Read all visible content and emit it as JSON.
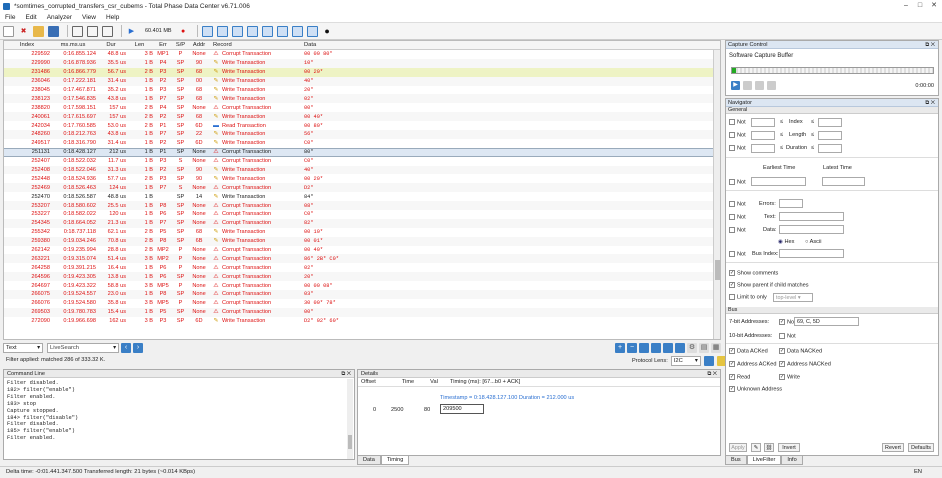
{
  "window": {
    "title": "*somtimes_corrupted_transfers_csr_cubems - Total Phase Data Center v6.71.006",
    "min": "–",
    "max": "□",
    "close": "✕"
  },
  "menu": [
    "File",
    "Edit",
    "Analyzer",
    "View",
    "Help"
  ],
  "toolbar": {
    "capture_size": "60.401 MB"
  },
  "table": {
    "headers": [
      "Index",
      "ms.ms.us",
      "Dur",
      "Len",
      "Err",
      "S/P",
      "Addr",
      "Record",
      "Data"
    ],
    "rows": [
      {
        "idx": "229592",
        "time": "0:16.855.124",
        "dur": "48.8 us",
        "len": "3 B",
        "err": "MP1",
        "sp": "P",
        "addr": "None",
        "icon": "warn",
        "rec": "Corrupt Transaction",
        "data": "00 00 80*",
        "style": "red"
      },
      {
        "idx": "229990",
        "time": "0:16.878.936",
        "dur": "35.5 us",
        "len": "1 B",
        "err": "P4",
        "sp": "SP",
        "addr": "90",
        "icon": "pen",
        "rec": "Write Transaction",
        "data": "10*",
        "style": "red"
      },
      {
        "idx": "231486",
        "time": "0:16.866.779",
        "dur": "56.7 us",
        "len": "2 B",
        "err": "P3",
        "sp": "SP",
        "addr": "68",
        "icon": "pen",
        "rec": "Write Transaction",
        "data": "00 20*",
        "style": "red hl1"
      },
      {
        "idx": "236046",
        "time": "0:17.222.181",
        "dur": "31.4 us",
        "len": "1 B",
        "err": "P2",
        "sp": "SP",
        "addr": "00",
        "icon": "pen",
        "rec": "Write Transaction",
        "data": "40*",
        "style": "red"
      },
      {
        "idx": "238045",
        "time": "0:17.467.871",
        "dur": "35.2 us",
        "len": "1 B",
        "err": "P3",
        "sp": "SP",
        "addr": "68",
        "icon": "pen",
        "rec": "Write Transaction",
        "data": "20*",
        "style": "red"
      },
      {
        "idx": "238123",
        "time": "0:17.546.835",
        "dur": "43.8 us",
        "len": "1 B",
        "err": "P7",
        "sp": "SP",
        "addr": "68",
        "icon": "pen",
        "rec": "Write Transaction",
        "data": "02*",
        "style": "red"
      },
      {
        "idx": "238820",
        "time": "0:17.598.151",
        "dur": "157 us",
        "len": "2 B",
        "err": "P4",
        "sp": "SP",
        "addr": "None",
        "icon": "warn",
        "rec": "Corrupt Transaction",
        "data": "00*",
        "style": "red"
      },
      {
        "idx": "240061",
        "time": "0:17.615.697",
        "dur": "157 us",
        "len": "2 B",
        "err": "P2",
        "sp": "SP",
        "addr": "68",
        "icon": "pen",
        "rec": "Write Transaction",
        "data": "00 40*",
        "style": "red"
      },
      {
        "idx": "242034",
        "time": "0:17.760.585",
        "dur": "53.0 us",
        "len": "2 B",
        "err": "P1",
        "sp": "SP",
        "addr": "6D",
        "icon": "read",
        "rec": "Read Transaction",
        "data": "00 80*",
        "style": "red"
      },
      {
        "idx": "248260",
        "time": "0:18.212.763",
        "dur": "43.8 us",
        "len": "1 B",
        "err": "P7",
        "sp": "SP",
        "addr": "22",
        "icon": "pen",
        "rec": "Write Transaction",
        "data": "56*",
        "style": "red"
      },
      {
        "idx": "249517",
        "time": "0:18.316.790",
        "dur": "31.4 us",
        "len": "1 B",
        "err": "P2",
        "sp": "SP",
        "addr": "6D",
        "icon": "pen",
        "rec": "Write Transaction",
        "data": "C0*",
        "style": "red"
      },
      {
        "idx": "251131",
        "time": "0:18.428.127",
        "dur": "212 us",
        "len": "1 B",
        "err": "P1",
        "sp": "SP",
        "addr": "None",
        "icon": "warn",
        "rec": "Corrupt Transaction",
        "data": "80*",
        "style": "hl2"
      },
      {
        "idx": "252407",
        "time": "0:18.522.032",
        "dur": "11.7 us",
        "len": "1 B",
        "err": "P3",
        "sp": "S",
        "addr": "None",
        "icon": "warn",
        "rec": "Corrupt Transaction",
        "data": "C0*",
        "style": "red"
      },
      {
        "idx": "252408",
        "time": "0:18.522.046",
        "dur": "31.3 us",
        "len": "1 B",
        "err": "P2",
        "sp": "SP",
        "addr": "90",
        "icon": "pen",
        "rec": "Write Transaction",
        "data": "40*",
        "style": "red"
      },
      {
        "idx": "252448",
        "time": "0:18.524.936",
        "dur": "57.7 us",
        "len": "2 B",
        "err": "P3",
        "sp": "SP",
        "addr": "90",
        "icon": "pen",
        "rec": "Write Transaction",
        "data": "00 20*",
        "style": "red"
      },
      {
        "idx": "252469",
        "time": "0:18.526.463",
        "dur": "124 us",
        "len": "1 B",
        "err": "P7",
        "sp": "S",
        "addr": "None",
        "icon": "warn",
        "rec": "Corrupt Transaction",
        "data": "D2*",
        "style": "red"
      },
      {
        "idx": "252470",
        "time": "0:18.526.587",
        "dur": "48.8 us",
        "len": "1 B",
        "err": "",
        "sp": "SP",
        "addr": "14",
        "icon": "pen",
        "rec": "Write Transaction",
        "data": "84*",
        "style": ""
      },
      {
        "idx": "253207",
        "time": "0:18.580.602",
        "dur": "25.5 us",
        "len": "1 B",
        "err": "P8",
        "sp": "SP",
        "addr": "None",
        "icon": "warn",
        "rec": "Corrupt Transaction",
        "data": "08*",
        "style": "red"
      },
      {
        "idx": "253227",
        "time": "0:18.582.022",
        "dur": "120 us",
        "len": "1 B",
        "err": "P6",
        "sp": "SP",
        "addr": "None",
        "icon": "warn",
        "rec": "Corrupt Transaction",
        "data": "C0*",
        "style": "red"
      },
      {
        "idx": "254345",
        "time": "0:18.664.052",
        "dur": "21.3 us",
        "len": "1 B",
        "err": "P7",
        "sp": "SP",
        "addr": "None",
        "icon": "warn",
        "rec": "Corrupt Transaction",
        "data": "82*",
        "style": "red"
      },
      {
        "idx": "255342",
        "time": "0:18.737.118",
        "dur": "62.1 us",
        "len": "2 B",
        "err": "P5",
        "sp": "SP",
        "addr": "68",
        "icon": "pen",
        "rec": "Write Transaction",
        "data": "00 10*",
        "style": "red"
      },
      {
        "idx": "259380",
        "time": "0:19.034.246",
        "dur": "70.8 us",
        "len": "2 B",
        "err": "P8",
        "sp": "SP",
        "addr": "6B",
        "icon": "pen",
        "rec": "Write Transaction",
        "data": "00 01*",
        "style": "red"
      },
      {
        "idx": "262142",
        "time": "0:19.235.994",
        "dur": "28.8 us",
        "len": "2 B",
        "err": "MP2",
        "sp": "P",
        "addr": "None",
        "icon": "warn",
        "rec": "Corrupt Transaction",
        "data": "00 40*",
        "style": "red"
      },
      {
        "idx": "263221",
        "time": "0:19.315.074",
        "dur": "51.4 us",
        "len": "3 B",
        "err": "MP2",
        "sp": "P",
        "addr": "None",
        "icon": "warn",
        "rec": "Corrupt Transaction",
        "data": "86* 2B* C0*",
        "style": "red"
      },
      {
        "idx": "264258",
        "time": "0:19.391.215",
        "dur": "16.4 us",
        "len": "1 B",
        "err": "P6",
        "sp": "P",
        "addr": "None",
        "icon": "warn",
        "rec": "Corrupt Transaction",
        "data": "02*",
        "style": "red"
      },
      {
        "idx": "264596",
        "time": "0:19.423.305",
        "dur": "13.8 us",
        "len": "1 B",
        "err": "P6",
        "sp": "SP",
        "addr": "None",
        "icon": "warn",
        "rec": "Corrupt Transaction",
        "data": "20*",
        "style": "red"
      },
      {
        "idx": "264697",
        "time": "0:19.423.322",
        "dur": "58.8 us",
        "len": "3 B",
        "err": "MP5",
        "sp": "P",
        "addr": "None",
        "icon": "warn",
        "rec": "Corrupt Transaction",
        "data": "00 00 08*",
        "style": "red"
      },
      {
        "idx": "266075",
        "time": "0:19.524.557",
        "dur": "23.0 us",
        "len": "1 B",
        "err": "P8",
        "sp": "SP",
        "addr": "None",
        "icon": "warn",
        "rec": "Corrupt Transaction",
        "data": "03*",
        "style": "red"
      },
      {
        "idx": "266076",
        "time": "0:19.524.580",
        "dur": "35.8 us",
        "len": "3 B",
        "err": "MP5",
        "sp": "P",
        "addr": "None",
        "icon": "warn",
        "rec": "Corrupt Transaction",
        "data": "30 00* 78*",
        "style": "red"
      },
      {
        "idx": "269503",
        "time": "0:19.780.783",
        "dur": "15.4 us",
        "len": "1 B",
        "err": "P5",
        "sp": "SP",
        "addr": "None",
        "icon": "warn",
        "rec": "Corrupt Transaction",
        "data": "00*",
        "style": "red"
      },
      {
        "idx": "272090",
        "time": "0:19.966.698",
        "dur": "162 us",
        "len": "3 B",
        "err": "P3",
        "sp": "SP",
        "addr": "6D",
        "icon": "pen",
        "rec": "Write Transaction",
        "data": "D2* 02* 60*",
        "style": "red"
      }
    ]
  },
  "search": {
    "mode": "Text",
    "placeholder": "LiveSearch",
    "filter_status": "Filter applied: matched 286 of 333.32 K.",
    "proto_label": "Protocol Lens:",
    "proto_value": "I2C"
  },
  "command": {
    "title": "Command Line",
    "lines": [
      "Filter disabled.",
      "182> filter(\"enable\")",
      "Filter enabled.",
      "183> stop",
      "Capture stopped.",
      "184> filter(\"disable\")",
      "Filter disabled.",
      "185> filter(\"enable\")",
      "Filter enabled."
    ]
  },
  "details": {
    "title": "Details",
    "headers": [
      "Offset",
      "Time",
      "Val",
      "Timing (ms): [67...b0 + ACK]"
    ],
    "timestamp": "Timestamp = 0:18.428.127.100  Duration = 212.000 us",
    "offset": "0",
    "time": "2500",
    "val": "80",
    "input": "209500",
    "tabs": [
      "Data",
      "Timing"
    ]
  },
  "capture": {
    "title": "Capture Control",
    "buffer": "Software Capture Buffer",
    "elapsed": "0:00:00"
  },
  "navigator": {
    "title": "Navigator",
    "general": "General",
    "not": "Not",
    "index": "Index",
    "length": "Length",
    "duration": "Duration",
    "earliest": "Earliest Time",
    "latest": "Latest Time",
    "errors": "Errors:",
    "text": "Text:",
    "data": "Data:",
    "hex": "Hex",
    "ascii": "Ascii",
    "bus_index": "Bus Index:",
    "show_comments": "Show comments",
    "show_parent": "Show parent if child matches",
    "limit": "Limit to only",
    "top_level": "top-level",
    "bus": "Bus",
    "addr7": "7-bit Addresses:",
    "addr7_value": "69, C, 5D",
    "addr10": "10-bit Addresses:",
    "data_acked": "Data ACKed",
    "data_nacked": "Data NACKed",
    "addr_acked": "Address ACKed",
    "addr_nacked": "Address NACKed",
    "read": "Read",
    "write": "Write",
    "unknown": "Unknown Address",
    "apply": "Apply",
    "invert": "Invert",
    "revert": "Revert",
    "defaults": "Defaults",
    "tabs": [
      "Bus",
      "LiveFilter",
      "Info"
    ]
  },
  "status": {
    "text": "Delta time: -0:01.441.347.500  Transferred length: 21 bytes (~0.014 KBps)",
    "lang": "EN"
  }
}
